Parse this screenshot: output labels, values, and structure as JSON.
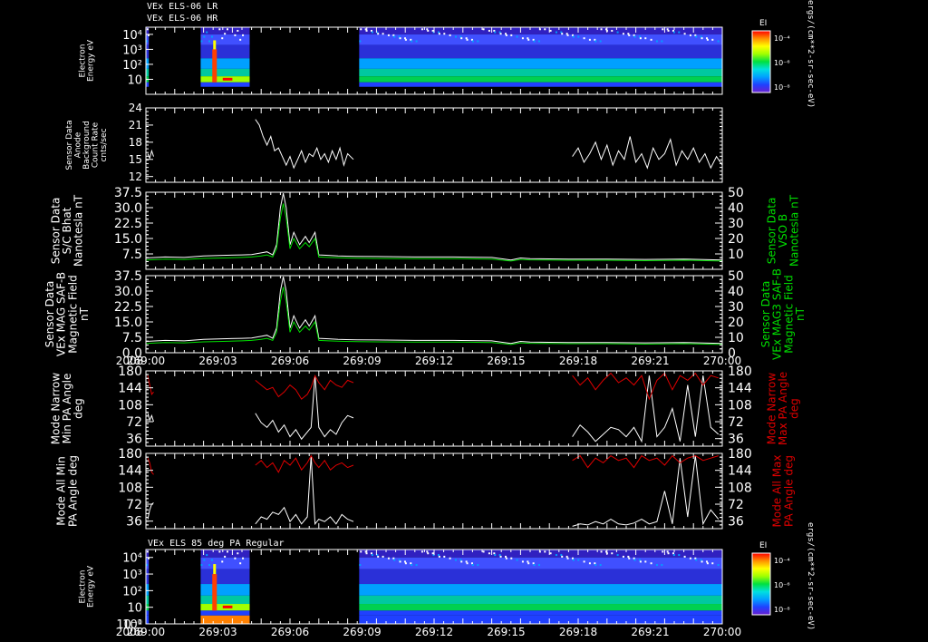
{
  "header": {
    "line1": "VEx ELS-06 LR",
    "line2": "VEx ELS-06 HR"
  },
  "footer": {
    "year_label": "2008"
  },
  "colorbar": {
    "title": "EI",
    "ticks": [
      "10⁻⁴",
      "10⁻⁶",
      "10⁻⁸"
    ],
    "unit": "ergs/(cm**2-sr-sec-eV)"
  },
  "chart_data": [
    {
      "type": "heatmap",
      "title": "",
      "ylabel": "Electron Energy eV",
      "yscale": "log",
      "ylim": [
        1,
        30000
      ],
      "y_ticks": [
        "10⁴",
        "10³",
        "10²",
        "10"
      ],
      "xlim": [
        "269:00",
        "270:00"
      ],
      "data_intervals": [
        [
          "269:00",
          "269:00.3"
        ],
        [
          "269:05.7",
          "269:10.8"
        ],
        [
          "269:22.2",
          "270:00"
        ]
      ]
    },
    {
      "type": "line",
      "ylabel": "Sensor Data Anode Background Count Rate cnts/sec",
      "ylim": [
        11,
        24
      ],
      "y_ticks": [
        "24",
        "21",
        "18",
        "15",
        "12"
      ],
      "series": [
        {
          "color": "#ffffff",
          "x": [
            0.1,
            0.2,
            0.3,
            0.4,
            5.7,
            5.9,
            6.1,
            6.3,
            6.5,
            6.7,
            6.9,
            7.1,
            7.3,
            7.5,
            7.7,
            7.9,
            8.1,
            8.3,
            8.5,
            8.7,
            8.9,
            9.1,
            9.3,
            9.5,
            9.7,
            9.9,
            10.1,
            10.3,
            10.5,
            10.8,
            22.2,
            22.5,
            22.8,
            23.1,
            23.4,
            23.7,
            24.0,
            24.3,
            24.6,
            24.9,
            25.2,
            25.5,
            25.8,
            26.1,
            26.4,
            26.7,
            27.0,
            27.3,
            27.6,
            27.9,
            28.2,
            28.5,
            28.8,
            29.1,
            29.4,
            29.7,
            30.0
          ],
          "values": [
            16,
            15.2,
            16.5,
            15.5,
            22,
            21,
            19,
            17.5,
            19,
            16.5,
            17,
            15.5,
            14,
            15.5,
            13.5,
            15,
            16.5,
            14.5,
            16,
            15.5,
            17,
            15,
            16,
            14.5,
            16.5,
            15,
            17,
            14,
            16,
            15,
            15.5,
            17,
            14.5,
            16,
            18,
            15,
            17.5,
            14,
            16.5,
            15,
            19,
            14.5,
            16,
            13.5,
            17,
            15,
            16,
            18.5,
            14,
            16.5,
            15,
            17,
            14.5,
            16,
            13.5,
            15.5,
            14
          ]
        }
      ]
    },
    {
      "type": "line",
      "ylabel": "Sensor Data S/C Bhat Nanotesla nT",
      "ylim": [
        0,
        37.5
      ],
      "y_ticks": [
        "37.5",
        "30.0",
        "22.5",
        "15.0",
        "7.5"
      ],
      "y2label": "Sensor Data VSO B Nanotesla nT",
      "y2lim": [
        0,
        50
      ],
      "y2_ticks": [
        "50",
        "40",
        "30",
        "20",
        "10"
      ],
      "series": [
        {
          "color": "#ffffff",
          "x": [
            0,
            1,
            2,
            3,
            4,
            5,
            5.5,
            6,
            6.3,
            6.6,
            6.8,
            7,
            7.15,
            7.3,
            7.5,
            7.7,
            8,
            8.3,
            8.5,
            8.8,
            9,
            9.5,
            10,
            11,
            12,
            14,
            16,
            18,
            19,
            19.5,
            20,
            22,
            24,
            26,
            28,
            30
          ],
          "values": [
            5.5,
            6,
            5.8,
            6.5,
            6.8,
            7,
            7.2,
            8,
            8.5,
            7,
            12,
            30,
            37,
            30,
            12,
            18,
            12,
            16,
            13,
            18,
            7,
            6.8,
            6.5,
            6.3,
            6.2,
            6,
            6,
            5.8,
            4.5,
            5.5,
            5.2,
            5,
            5,
            4.8,
            5,
            4.5
          ]
        },
        {
          "color": "#00dd00",
          "x": [
            0,
            1,
            2,
            3,
            4,
            5,
            5.5,
            6,
            6.3,
            6.6,
            6.8,
            7,
            7.15,
            7.3,
            7.5,
            7.7,
            8,
            8.3,
            8.5,
            8.8,
            9,
            9.5,
            10,
            11,
            12,
            14,
            16,
            18,
            19,
            19.5,
            20,
            22,
            24,
            26,
            28,
            30
          ],
          "values": [
            4.5,
            5,
            4.8,
            5.3,
            5.5,
            5.8,
            6,
            6.5,
            7,
            6,
            10,
            25,
            32,
            25,
            10,
            15,
            10,
            13,
            11,
            15,
            6,
            5.8,
            5.6,
            5.4,
            5.3,
            5.2,
            5.2,
            5,
            4,
            4.8,
            4.6,
            4.4,
            4.4,
            4.2,
            4.4,
            4
          ]
        }
      ]
    },
    {
      "type": "line",
      "ylabel": "Sensor Data VEx MAG SAF-B Magnetic Field nT",
      "ylim": [
        0,
        37.5
      ],
      "y_ticks": [
        "37.5",
        "30.0",
        "22.5",
        "15.0",
        "7.5",
        "0.0"
      ],
      "y2label": "Sensor Data VEx MAG3 SAF-B Magnetic Field nT",
      "y2lim": [
        0,
        50
      ],
      "y2_ticks": [
        "50",
        "40",
        "30",
        "20",
        "10",
        "0"
      ],
      "series": [
        {
          "color": "#ffffff",
          "x": [
            0,
            1,
            2,
            3,
            4,
            5,
            5.5,
            6,
            6.3,
            6.6,
            6.8,
            7,
            7.15,
            7.3,
            7.5,
            7.7,
            8,
            8.3,
            8.5,
            8.8,
            9,
            9.5,
            10,
            11,
            12,
            14,
            16,
            18,
            19,
            19.5,
            20,
            22,
            24,
            26,
            28,
            30
          ],
          "values": [
            5.5,
            6,
            5.8,
            6.5,
            6.8,
            7,
            7.2,
            8,
            8.5,
            7,
            12,
            30,
            37,
            30,
            12,
            18,
            12,
            16,
            13,
            18,
            7,
            6.8,
            6.5,
            6.3,
            6.2,
            6,
            6,
            5.8,
            4.5,
            5.5,
            5.2,
            5,
            5,
            4.8,
            5,
            4.5
          ]
        },
        {
          "color": "#00dd00",
          "x": [
            0,
            1,
            2,
            3,
            4,
            5,
            5.5,
            6,
            6.3,
            6.6,
            6.8,
            7,
            7.15,
            7.3,
            7.5,
            7.7,
            8,
            8.3,
            8.5,
            8.8,
            9,
            9.5,
            10,
            11,
            12,
            14,
            16,
            18,
            19,
            19.5,
            20,
            22,
            24,
            26,
            28,
            30
          ],
          "values": [
            4.5,
            5,
            4.8,
            5.3,
            5.5,
            5.8,
            6,
            6.5,
            7,
            6,
            10,
            25,
            32,
            25,
            10,
            15,
            10,
            13,
            11,
            15,
            6,
            5.8,
            5.6,
            5.4,
            5.3,
            5.2,
            5.2,
            5,
            4,
            4.8,
            4.6,
            4.4,
            4.4,
            4.2,
            4.4,
            4
          ]
        }
      ]
    },
    {
      "type": "line",
      "ylabel": "Mode Narrow Min PA Angle deg",
      "ylim": [
        20,
        180
      ],
      "y_ticks": [
        "180",
        "144",
        "108",
        "72",
        "36"
      ],
      "y2label": "Mode Narrow Max PA Angle deg",
      "y2_ticks": [
        "180",
        "144",
        "108",
        "72",
        "36"
      ],
      "series": [
        {
          "color": "#ffffff",
          "x": [
            0.1,
            0.2,
            0.3,
            0.4,
            5.7,
            6.0,
            6.3,
            6.6,
            6.9,
            7.2,
            7.5,
            7.8,
            8.1,
            8.4,
            8.6,
            8.8,
            9.0,
            9.3,
            9.6,
            9.9,
            10.2,
            10.5,
            10.8,
            22.2,
            22.6,
            23.0,
            23.4,
            23.8,
            24.2,
            24.6,
            25.0,
            25.4,
            25.8,
            26.2,
            26.6,
            27.0,
            27.4,
            27.8,
            28.2,
            28.6,
            29.0,
            29.4,
            29.8
          ],
          "values": [
            90,
            75,
            85,
            72,
            90,
            70,
            60,
            75,
            50,
            65,
            40,
            55,
            35,
            50,
            60,
            170,
            60,
            40,
            55,
            45,
            70,
            85,
            80,
            40,
            65,
            50,
            30,
            45,
            60,
            55,
            40,
            60,
            30,
            170,
            40,
            60,
            100,
            30,
            150,
            40,
            170,
            60,
            45
          ]
        },
        {
          "color": "#dd0000",
          "x": [
            0.1,
            0.2,
            0.3,
            0.4,
            5.7,
            6.0,
            6.3,
            6.6,
            6.9,
            7.2,
            7.5,
            7.8,
            8.1,
            8.4,
            8.6,
            8.8,
            9.0,
            9.3,
            9.6,
            9.9,
            10.2,
            10.5,
            10.8,
            22.2,
            22.6,
            23.0,
            23.4,
            23.8,
            24.2,
            24.6,
            25.0,
            25.4,
            25.8,
            26.2,
            26.6,
            27.0,
            27.4,
            27.8,
            28.2,
            28.6,
            29.0,
            29.4,
            29.8
          ],
          "values": [
            170,
            150,
            130,
            135,
            160,
            150,
            140,
            145,
            125,
            135,
            150,
            140,
            120,
            130,
            145,
            170,
            155,
            140,
            160,
            150,
            145,
            160,
            155,
            170,
            150,
            165,
            140,
            160,
            175,
            155,
            165,
            150,
            170,
            120,
            160,
            175,
            140,
            170,
            160,
            175,
            150,
            170,
            165
          ]
        }
      ]
    },
    {
      "type": "line",
      "ylabel": "Mode All Min PA Angle deg",
      "ylim": [
        20,
        180
      ],
      "y_ticks": [
        "180",
        "144",
        "108",
        "72",
        "36"
      ],
      "y2label": "Mode All Max PA Angle deg",
      "y2_ticks": [
        "180",
        "144",
        "108",
        "72",
        "36"
      ],
      "series": [
        {
          "color": "#ffffff",
          "x": [
            0.1,
            0.2,
            0.3,
            0.4,
            5.7,
            6.0,
            6.3,
            6.6,
            6.9,
            7.2,
            7.5,
            7.8,
            8.1,
            8.4,
            8.6,
            8.8,
            9.0,
            9.3,
            9.6,
            9.9,
            10.2,
            10.5,
            10.8,
            22.2,
            22.6,
            23.0,
            23.4,
            23.8,
            24.2,
            24.6,
            25.0,
            25.4,
            25.8,
            26.2,
            26.6,
            27.0,
            27.4,
            27.8,
            28.2,
            28.6,
            29.0,
            29.4,
            29.8
          ],
          "values": [
            40,
            60,
            72,
            75,
            30,
            45,
            40,
            55,
            50,
            65,
            35,
            50,
            30,
            45,
            175,
            30,
            40,
            35,
            45,
            30,
            50,
            40,
            35,
            25,
            30,
            28,
            35,
            30,
            40,
            30,
            28,
            32,
            40,
            30,
            35,
            100,
            30,
            170,
            45,
            175,
            30,
            60,
            40
          ]
        },
        {
          "color": "#dd0000",
          "x": [
            0.1,
            0.2,
            0.3,
            0.4,
            5.7,
            6.0,
            6.3,
            6.6,
            6.9,
            7.2,
            7.5,
            7.8,
            8.1,
            8.4,
            8.6,
            8.8,
            9.0,
            9.3,
            9.6,
            9.9,
            10.2,
            10.5,
            10.8,
            22.2,
            22.6,
            23.0,
            23.4,
            23.8,
            24.2,
            24.6,
            25.0,
            25.4,
            25.8,
            26.2,
            26.6,
            27.0,
            27.4,
            27.8,
            28.2,
            28.6,
            29.0,
            29.4,
            29.8
          ],
          "values": [
            170,
            160,
            140,
            135,
            155,
            165,
            150,
            160,
            140,
            165,
            155,
            170,
            145,
            160,
            175,
            160,
            150,
            165,
            145,
            155,
            160,
            150,
            155,
            165,
            175,
            150,
            170,
            160,
            175,
            165,
            170,
            150,
            175,
            165,
            170,
            155,
            175,
            160,
            170,
            175,
            165,
            170,
            175
          ]
        }
      ]
    },
    {
      "type": "heatmap",
      "title": "VEx ELS 85 deg PA Regular",
      "ylabel": "Electron Energy eV",
      "yscale": "log",
      "ylim": [
        1,
        30000
      ],
      "y_ticks": [
        "10⁴",
        "10³",
        "10²",
        "10",
        "10⁰",
        "10⁻¹"
      ],
      "xlim": [
        "269:00",
        "270:00"
      ],
      "data_intervals": [
        [
          "269:00",
          "269:00.3"
        ],
        [
          "269:05.7",
          "269:10.8"
        ],
        [
          "269:22.2",
          "270:00"
        ]
      ],
      "x_ticks": [
        "269:00",
        "269:03",
        "269:06",
        "269:09",
        "269:12",
        "269:15",
        "269:18",
        "269:21",
        "270:00"
      ]
    }
  ]
}
